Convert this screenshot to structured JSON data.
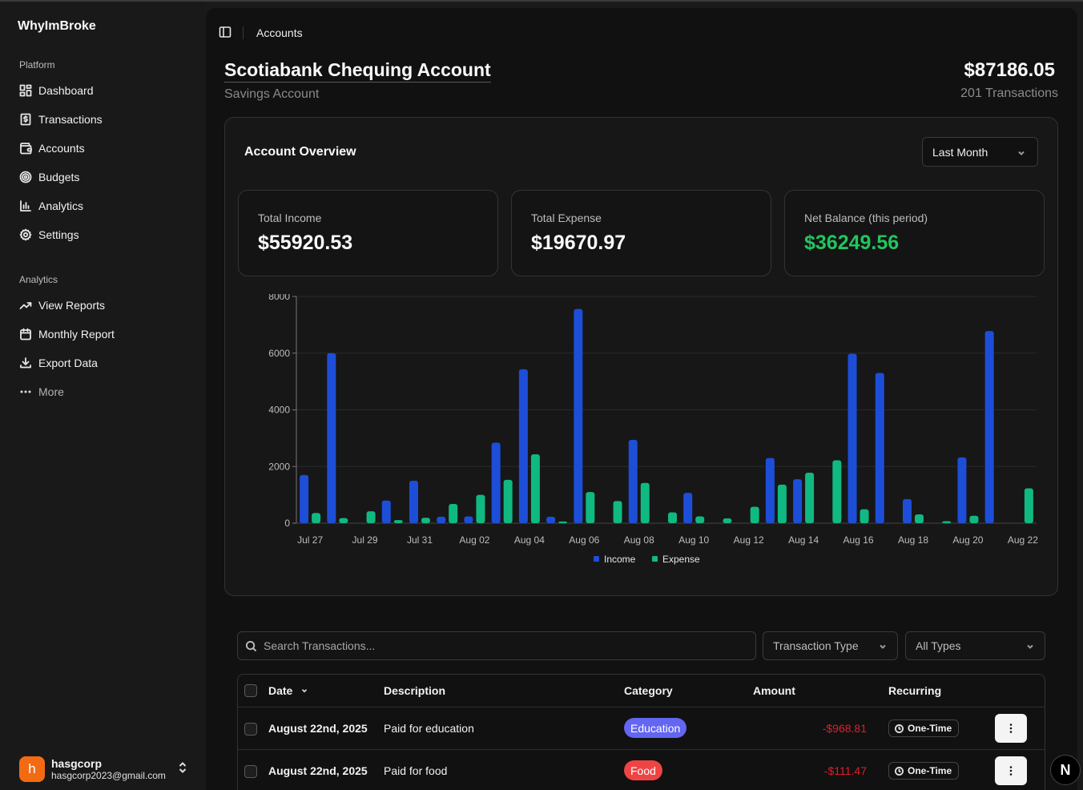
{
  "app": {
    "name": "WhyImBroke"
  },
  "sidebar": {
    "platform_label": "Platform",
    "platform_items": [
      {
        "label": "Dashboard",
        "icon": "dashboard-icon"
      },
      {
        "label": "Transactions",
        "icon": "receipt-icon"
      },
      {
        "label": "Accounts",
        "icon": "wallet-icon"
      },
      {
        "label": "Budgets",
        "icon": "target-icon"
      },
      {
        "label": "Analytics",
        "icon": "bar-chart-icon"
      },
      {
        "label": "Settings",
        "icon": "gear-icon"
      }
    ],
    "analytics_label": "Analytics",
    "analytics_items": [
      {
        "label": "View Reports",
        "icon": "trending-up-icon"
      },
      {
        "label": "Monthly Report",
        "icon": "calendar-icon"
      },
      {
        "label": "Export Data",
        "icon": "download-icon"
      },
      {
        "label": "More",
        "icon": "more-icon"
      }
    ],
    "user": {
      "initial": "h",
      "name": "hasgcorp",
      "email": "hasgcorp2023@gmail.com"
    }
  },
  "header": {
    "breadcrumb": "Accounts"
  },
  "account": {
    "name": "Scotiabank Chequing Account",
    "type": "Savings Account",
    "balance": "$87186.05",
    "transactions_count": "201 Transactions"
  },
  "overview": {
    "title": "Account Overview",
    "period": "Last Month",
    "stats": [
      {
        "label": "Total Income",
        "value": "$55920.53"
      },
      {
        "label": "Total Expense",
        "value": "$19670.97"
      },
      {
        "label": "Net Balance (this period)",
        "value": "$36249.56"
      }
    ]
  },
  "colors": {
    "income": "#1d4ed8",
    "expense": "#10b981",
    "net_positive": "#22c55e",
    "negative_amount": "#e11d2e",
    "education_badge": "#6366f1",
    "food_badge": "#ef4444"
  },
  "chart_data": {
    "type": "bar",
    "categories": [
      "Jul 27",
      "Jul 28",
      "Jul 29",
      "Jul 30",
      "Jul 31",
      "Aug 01",
      "Aug 02",
      "Aug 03",
      "Aug 04",
      "Aug 05",
      "Aug 06",
      "Aug 07",
      "Aug 08",
      "Aug 09",
      "Aug 10",
      "Aug 11",
      "Aug 12",
      "Aug 13",
      "Aug 14",
      "Aug 15",
      "Aug 16",
      "Aug 17",
      "Aug 18",
      "Aug 19",
      "Aug 20",
      "Aug 21",
      "Aug 22"
    ],
    "tick_labels": [
      "Jul 27",
      "",
      "Jul 29",
      "",
      "Jul 31",
      "",
      "Aug 02",
      "",
      "Aug 04",
      "",
      "Aug 06",
      "",
      "Aug 08",
      "",
      "Aug 10",
      "",
      "Aug 12",
      "",
      "Aug 14",
      "",
      "Aug 16",
      "",
      "Aug 18",
      "",
      "Aug 20",
      "",
      "Aug 22"
    ],
    "series": [
      {
        "name": "Income",
        "values": [
          1700,
          6000,
          0,
          800,
          1500,
          230,
          240,
          2840,
          5430,
          230,
          7560,
          0,
          2940,
          0,
          1070,
          0,
          0,
          2300,
          1550,
          0,
          5980,
          5300,
          850,
          0,
          2320,
          6780,
          0
        ]
      },
      {
        "name": "Expense",
        "values": [
          360,
          180,
          420,
          110,
          190,
          680,
          1000,
          1530,
          2430,
          60,
          1100,
          780,
          1420,
          380,
          240,
          170,
          580,
          1360,
          1780,
          2220,
          490,
          0,
          310,
          70,
          260,
          0,
          1230
        ]
      }
    ],
    "ylim": [
      0,
      8000
    ],
    "yticks": [
      0,
      2000,
      4000,
      6000,
      8000
    ],
    "grid": true,
    "legend_position": "bottom"
  },
  "filters": {
    "search_placeholder": "Search Transactions...",
    "type_select": "Transaction Type",
    "all_types_select": "All Types"
  },
  "table": {
    "headers": {
      "date": "Date",
      "description": "Description",
      "category": "Category",
      "amount": "Amount",
      "recurring": "Recurring"
    },
    "rows": [
      {
        "date": "August 22nd, 2025",
        "description": "Paid for education",
        "category": "Education",
        "amount": "-$968.81",
        "recurring": "One-Time"
      },
      {
        "date": "August 22nd, 2025",
        "description": "Paid for food",
        "category": "Food",
        "amount": "-$111.47",
        "recurring": "One-Time"
      }
    ]
  },
  "floating_badge": "N"
}
